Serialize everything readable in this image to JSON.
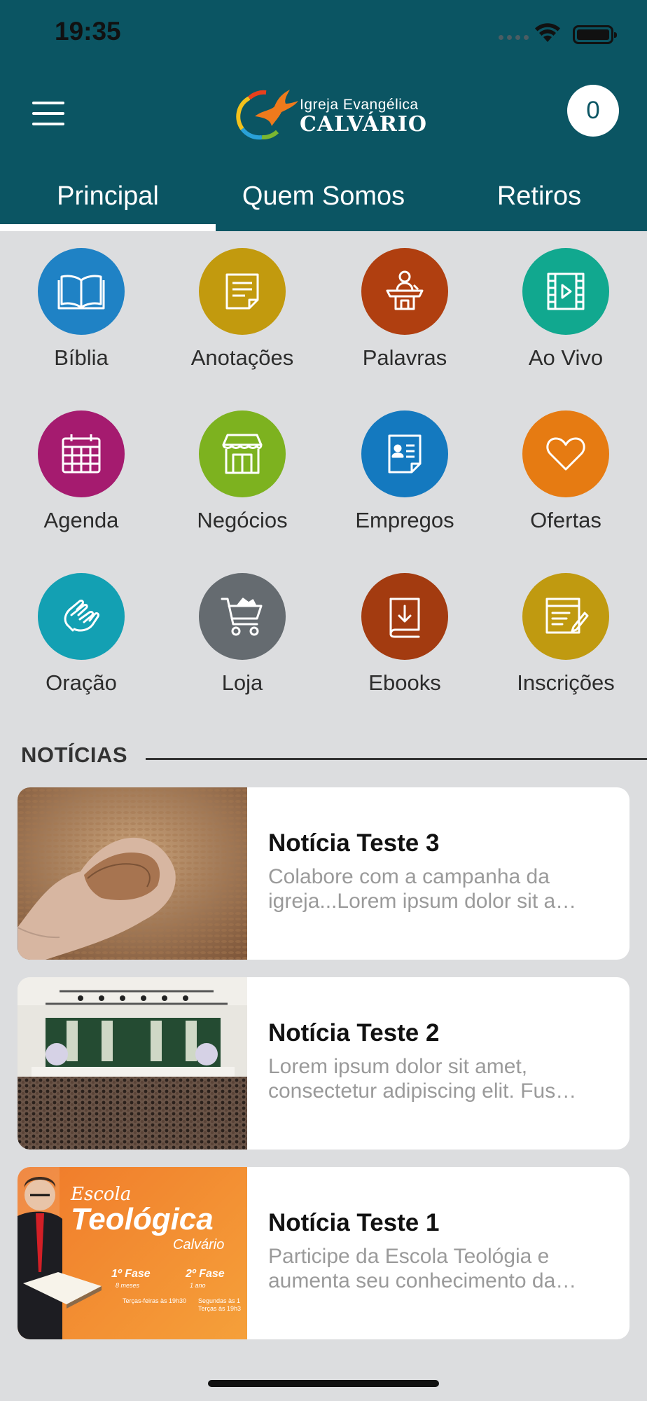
{
  "status_bar": {
    "time": "19:35"
  },
  "header": {
    "logo_line1": "Igreja Evangélica",
    "logo_line2": "CALVÁRIO",
    "cart_count": "0",
    "background": "#0b5563"
  },
  "tabs": [
    {
      "label": "Principal",
      "active": true
    },
    {
      "label": "Quem Somos",
      "active": false
    },
    {
      "label": "Retiros",
      "active": false
    }
  ],
  "shortcuts": [
    {
      "label": "Bíblia",
      "icon": "book-icon",
      "color": "#1f82c5"
    },
    {
      "label": "Anotações",
      "icon": "note-icon",
      "color": "#c29a0e"
    },
    {
      "label": "Palavras",
      "icon": "pulpit-icon",
      "color": "#b03f10"
    },
    {
      "label": "Ao Vivo",
      "icon": "video-icon",
      "color": "#11a88f"
    },
    {
      "label": "Agenda",
      "icon": "calendar-icon",
      "color": "#a51b6f"
    },
    {
      "label": "Negócios",
      "icon": "store-icon",
      "color": "#7db21f"
    },
    {
      "label": "Empregos",
      "icon": "profile-card-icon",
      "color": "#1479bf"
    },
    {
      "label": "Ofertas",
      "icon": "heart-icon",
      "color": "#e67b12"
    },
    {
      "label": "Oração",
      "icon": "praying-hands-icon",
      "color": "#13a0b3"
    },
    {
      "label": "Loja",
      "icon": "cart-icon",
      "color": "#656b70"
    },
    {
      "label": "Ebooks",
      "icon": "ebook-download-icon",
      "color": "#a33b10"
    },
    {
      "label": "Inscrições",
      "icon": "form-edit-icon",
      "color": "#c09a10"
    }
  ],
  "news": {
    "heading": "NOTÍCIAS",
    "items": [
      {
        "title": "Notícia Teste 3",
        "desc_line1": "Colabore com a campanha da",
        "desc_line2": "igreja...Lorem ipsum dolor sit a…"
      },
      {
        "title": "Notícia Teste 2",
        "desc_line1": "Lorem ipsum dolor sit amet,",
        "desc_line2": "consectetur adipiscing elit. Fus…"
      },
      {
        "title": "Notícia Teste 1",
        "desc_line1": "Participe da Escola Teológia e",
        "desc_line2": "aumenta seu conhecimento da…"
      }
    ],
    "poster": {
      "line1": "Escola",
      "line2": "Teológica",
      "line3": "Calvário",
      "phase1": "1º Fase",
      "phase1_sub": "8 meses",
      "phase2": "2º Fase",
      "phase2_sub": "1 ano",
      "schedule1": "Terças-feiras às 19h30",
      "schedule2": "Segundas às 1",
      "schedule3": "Terças às 19h3"
    }
  }
}
